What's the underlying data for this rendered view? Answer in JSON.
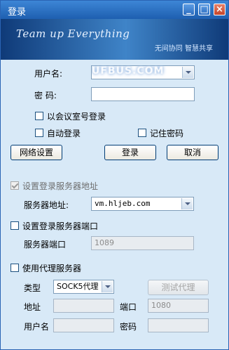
{
  "window": {
    "title": "登录"
  },
  "banner": {
    "slogan_en": "Team up Everything",
    "slogan_cn": "无间协同  智慧共享"
  },
  "login": {
    "username_label": "用户名:",
    "username_value": "",
    "password_label": "密  码:",
    "password_value": "",
    "meeting_room_label": "以会议室号登录",
    "auto_login_label": "自动登录",
    "remember_password_label": "记住密码"
  },
  "buttons": {
    "network": "网络设置",
    "login": "登录",
    "cancel": "取消"
  },
  "server": {
    "set_address_label": "设置登录服务器地址",
    "set_address_checked": true,
    "address_label": "服务器地址:",
    "address_value": "vm.hljeb.com",
    "set_port_label": "设置登录服务器端口",
    "set_port_checked": false,
    "port_label": "服务器端口",
    "port_value": "1089"
  },
  "proxy": {
    "use_proxy_label": "使用代理服务器",
    "use_proxy_checked": false,
    "type_label": "类型",
    "type_value": "SOCK5代理",
    "test_button": "测试代理",
    "address_label": "地址",
    "address_value": "",
    "port_label": "端口",
    "port_value": "1080",
    "username_label": "用户名",
    "username_value": "",
    "password_label": "密码",
    "password_value": ""
  }
}
